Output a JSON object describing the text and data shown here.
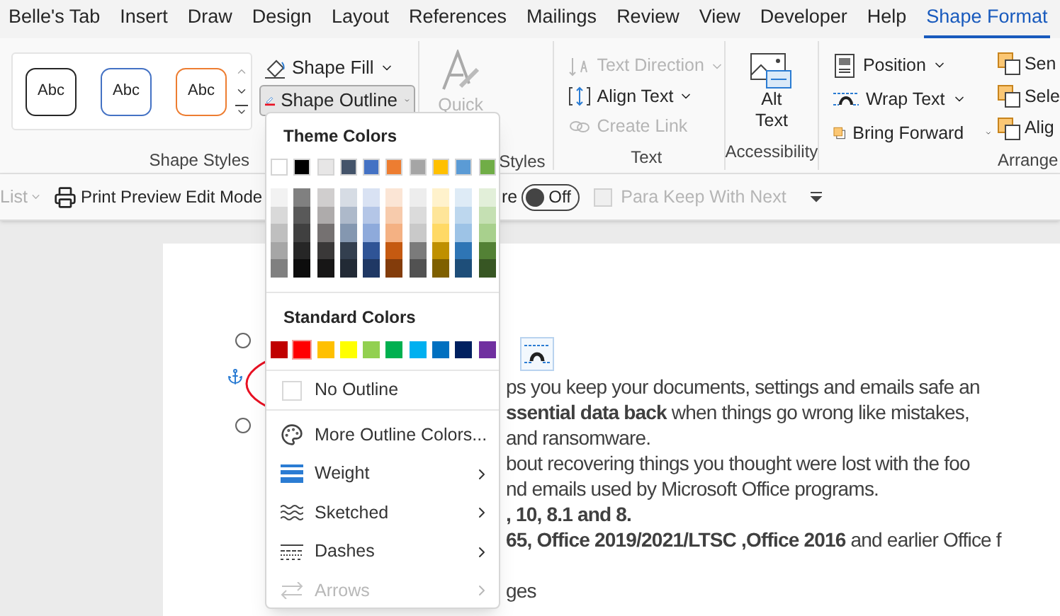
{
  "tabs": [
    {
      "label": "Belle's Tab",
      "selected": false
    },
    {
      "label": "Insert",
      "selected": false
    },
    {
      "label": "Draw",
      "selected": false
    },
    {
      "label": "Design",
      "selected": false
    },
    {
      "label": "Layout",
      "selected": false
    },
    {
      "label": "References",
      "selected": false
    },
    {
      "label": "Mailings",
      "selected": false
    },
    {
      "label": "Review",
      "selected": false
    },
    {
      "label": "View",
      "selected": false
    },
    {
      "label": "Developer",
      "selected": false
    },
    {
      "label": "Help",
      "selected": false
    },
    {
      "label": "Shape Format",
      "selected": true
    }
  ],
  "shape_styles": {
    "presets": [
      {
        "label": "Abc",
        "color": "#262626"
      },
      {
        "label": "Abc",
        "color": "#4472c4"
      },
      {
        "label": "Abc",
        "color": "#ed7d31"
      }
    ],
    "group_label": "Shape Styles"
  },
  "shape_fill": {
    "label": "Shape Fill"
  },
  "shape_outline": {
    "label": "Shape Outline",
    "expanded": true
  },
  "wordart": {
    "quick_label": "Quick",
    "group_label": "Styles"
  },
  "text_group": {
    "items": [
      {
        "label": "Text Direction",
        "disabled": true,
        "kind": "direction"
      },
      {
        "label": "Align Text",
        "disabled": false,
        "kind": "align"
      },
      {
        "label": "Create Link",
        "disabled": true,
        "kind": "link"
      }
    ],
    "group_label": "Text"
  },
  "accessibility": {
    "button": "Alt Text",
    "group_label": "Accessibility"
  },
  "arrange": {
    "items": [
      {
        "label": "Position",
        "kind": "position"
      },
      {
        "label": "Wrap Text",
        "kind": "wrap"
      },
      {
        "label": "Bring Forward",
        "kind": "forward"
      }
    ],
    "cut_items": [
      "Sen",
      "Sele",
      "Alig"
    ],
    "group_label": "Arrange"
  },
  "quick_bar": {
    "list_label": "List",
    "print_preview": "Print Preview Edit Mode",
    "partial_label": "re",
    "toggle": {
      "label": "Off",
      "on": false
    },
    "checkbox": {
      "label": "Para Keep With Next",
      "checked": false,
      "disabled": true
    }
  },
  "document": {
    "lines": [
      {
        "text": "ps you keep your documents, settings and emails safe an",
        "bold": false
      },
      {
        "text": "**ssential data back** when things go wrong like mistakes,",
        "bold": false
      },
      {
        "text": "and ransomware.",
        "bold": false
      },
      {
        "text": "bout recovering things you thought were lost with the foo",
        "bold": false
      },
      {
        "text": "nd emails used by Microsoft Office programs.",
        "bold": false
      },
      {
        "text": ", 10, 8.1 and 8.",
        "bold": true
      },
      {
        "text": "**65, Office 2019/2021/LTSC ,Office 2016** and earlier Office f",
        "bold": false
      },
      {
        "text": "ges",
        "bold": false
      }
    ]
  },
  "shape_outline_menu": {
    "theme_colors_label": "Theme Colors",
    "theme_colors": [
      {
        "color": "#ffffff",
        "shades": [
          {
            "color": "#f2f2f2"
          },
          {
            "color": "#d9d9d9"
          },
          {
            "color": "#bfbfbf"
          },
          {
            "color": "#a6a6a6"
          },
          {
            "color": "#808080"
          }
        ]
      },
      {
        "color": "#000000",
        "shades": [
          {
            "color": "#808080"
          },
          {
            "color": "#595959"
          },
          {
            "color": "#404040"
          },
          {
            "color": "#262626"
          },
          {
            "color": "#0d0d0d"
          }
        ]
      },
      {
        "color": "#e7e6e6",
        "shades": [
          {
            "color": "#d0cece"
          },
          {
            "color": "#aeabab"
          },
          {
            "color": "#757171"
          },
          {
            "color": "#3a3838"
          },
          {
            "color": "#171616"
          }
        ]
      },
      {
        "color": "#44546a",
        "shades": [
          {
            "color": "#d6dce4"
          },
          {
            "color": "#adb9ca"
          },
          {
            "color": "#8497b0"
          },
          {
            "color": "#333f4f"
          },
          {
            "color": "#222a35"
          }
        ]
      },
      {
        "color": "#4472c4",
        "shades": [
          {
            "color": "#d9e2f3"
          },
          {
            "color": "#b4c6e7"
          },
          {
            "color": "#8eaadb"
          },
          {
            "color": "#2f5496"
          },
          {
            "color": "#1f3864"
          }
        ]
      },
      {
        "color": "#ed7d31",
        "shades": [
          {
            "color": "#fbe5d5"
          },
          {
            "color": "#f7cbac"
          },
          {
            "color": "#f4b183"
          },
          {
            "color": "#c55a11"
          },
          {
            "color": "#833c0b"
          }
        ]
      },
      {
        "color": "#a5a5a5",
        "shades": [
          {
            "color": "#ededed"
          },
          {
            "color": "#dbdbdb"
          },
          {
            "color": "#c9c9c9"
          },
          {
            "color": "#7b7b7b"
          },
          {
            "color": "#525252"
          }
        ]
      },
      {
        "color": "#ffc000",
        "shades": [
          {
            "color": "#fff2cc"
          },
          {
            "color": "#fee599"
          },
          {
            "color": "#ffd965"
          },
          {
            "color": "#bf9000"
          },
          {
            "color": "#7f6000"
          }
        ]
      },
      {
        "color": "#5b9bd5",
        "shades": [
          {
            "color": "#deebf6"
          },
          {
            "color": "#bdd7ee"
          },
          {
            "color": "#9dc3e6"
          },
          {
            "color": "#2e75b5"
          },
          {
            "color": "#1e4e79"
          }
        ]
      },
      {
        "color": "#70ad47",
        "shades": [
          {
            "color": "#e2efd9"
          },
          {
            "color": "#c5e0b3"
          },
          {
            "color": "#a8d08d"
          },
          {
            "color": "#538135"
          },
          {
            "color": "#375623"
          }
        ]
      }
    ],
    "standard_colors_label": "Standard Colors",
    "standard_colors": [
      {
        "color": "#c00000",
        "selected": false
      },
      {
        "color": "#ff0000",
        "selected": true
      },
      {
        "color": "#ffc000",
        "selected": false
      },
      {
        "color": "#ffff00",
        "selected": false
      },
      {
        "color": "#92d050",
        "selected": false
      },
      {
        "color": "#00b050",
        "selected": false
      },
      {
        "color": "#00b0f0",
        "selected": false
      },
      {
        "color": "#0070c0",
        "selected": false
      },
      {
        "color": "#002060",
        "selected": false
      },
      {
        "color": "#7030a0",
        "selected": false
      }
    ],
    "items": [
      {
        "label": "No Outline",
        "kind": "none",
        "disabled": false,
        "submenu": false
      },
      {
        "label": "More Outline Colors...",
        "kind": "palette",
        "disabled": false,
        "submenu": false
      },
      {
        "label": "Weight",
        "kind": "weight",
        "disabled": false,
        "submenu": true
      },
      {
        "label": "Sketched",
        "kind": "sketched",
        "disabled": false,
        "submenu": true
      },
      {
        "label": "Dashes",
        "kind": "dashes",
        "disabled": false,
        "submenu": true
      },
      {
        "label": "Arrows",
        "kind": "arrows",
        "disabled": true,
        "submenu": true
      }
    ]
  }
}
